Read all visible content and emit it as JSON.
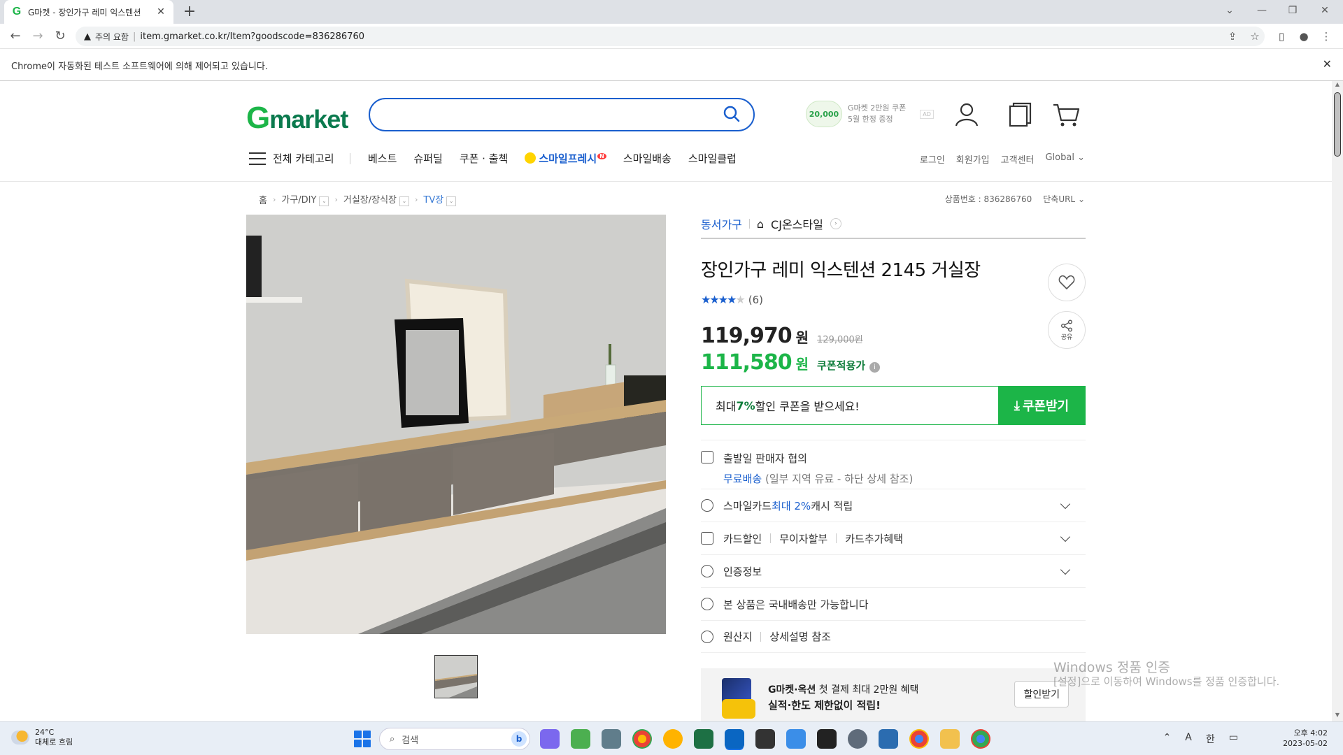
{
  "browser": {
    "tab_title": "G마켓 - 장인가구 레미 익스텐션",
    "security_label": "주의 요함",
    "url": "item.gmarket.co.kr/Item?goodscode=836286760",
    "automation_notice": "Chrome이 자동화된 테스트 소프트웨어에 의해 제어되고 있습니다."
  },
  "header": {
    "logo": "Gmarket",
    "search_placeholder": "",
    "promo_coin": "20,000",
    "promo_line1": "G마켓 2만원 쿠폰",
    "promo_line2": "5월 한정 증정",
    "promo_ad": "AD",
    "all_categories": "전체 카테고리",
    "gnb": [
      "베스트",
      "슈퍼딜",
      "쿠폰 · 출첵",
      "스마일프레시",
      "스마일배송",
      "스마일클럽"
    ],
    "smile_badge": "N",
    "util": [
      "로그인",
      "회원가입",
      "고객센터",
      "Global"
    ]
  },
  "breadcrumb": {
    "home": "홈",
    "cat1": "가구/DIY",
    "cat2": "거실장/장식장",
    "cat3": "TV장",
    "product_no": "상품번호 : 836286760",
    "short_url": "단축URL"
  },
  "product": {
    "seller": "동서가구",
    "shop": "CJ온스타일",
    "title": "장인가구 레미 익스텐션 2145 거실장",
    "rating": 4,
    "review_count": "(6)",
    "price": "119,970",
    "price_unit": "원",
    "original_price": "129,000원",
    "coupon_price": "111,580",
    "coupon_price_label": "쿠폰적용가",
    "coupon_msg_prefix": "최대 ",
    "coupon_msg_pct": "7%",
    "coupon_msg_suffix": " 할인 쿠폰을 받으세요!",
    "coupon_btn": "쿠폰받기",
    "share_label": "공유"
  },
  "info_rows": {
    "ship_line1": "출발일 판매자 협의",
    "ship_free": "무료배송",
    "ship_note": " (일부 지역 유료 - 하단 상세 참조)",
    "smilecard_a": "스마일카드 ",
    "smilecard_b": "최대 2%",
    "smilecard_c": " 캐시 적립",
    "card_discount": "카드할인",
    "installment": "무이자할부",
    "card_extra": "카드추가혜택",
    "certification": "인증정보",
    "domestic": "본 상품은 국내배송만 가능합니다",
    "origin": "원산지",
    "origin_value": "상세설명 참조"
  },
  "banner": {
    "line1_bold": "G마켓·옥션",
    "line1_rest": " 첫 결제 최대 2만원 혜택",
    "line2": "실적·한도 제한없이 적립!",
    "button": "할인받기"
  },
  "watermark": {
    "line1": "Windows 정품 인증",
    "line2": "[설정]으로 이동하여 Windows를 정품 인증합니다."
  },
  "taskbar": {
    "temp": "24°C",
    "weather": "대체로 흐림",
    "search": "검색",
    "ime_a": "A",
    "ime_han": "한",
    "time": "오후 4:02",
    "date": "2023-05-02"
  },
  "colors": {
    "gmarket_green": "#1cb548",
    "link_blue": "#1a5fce"
  }
}
